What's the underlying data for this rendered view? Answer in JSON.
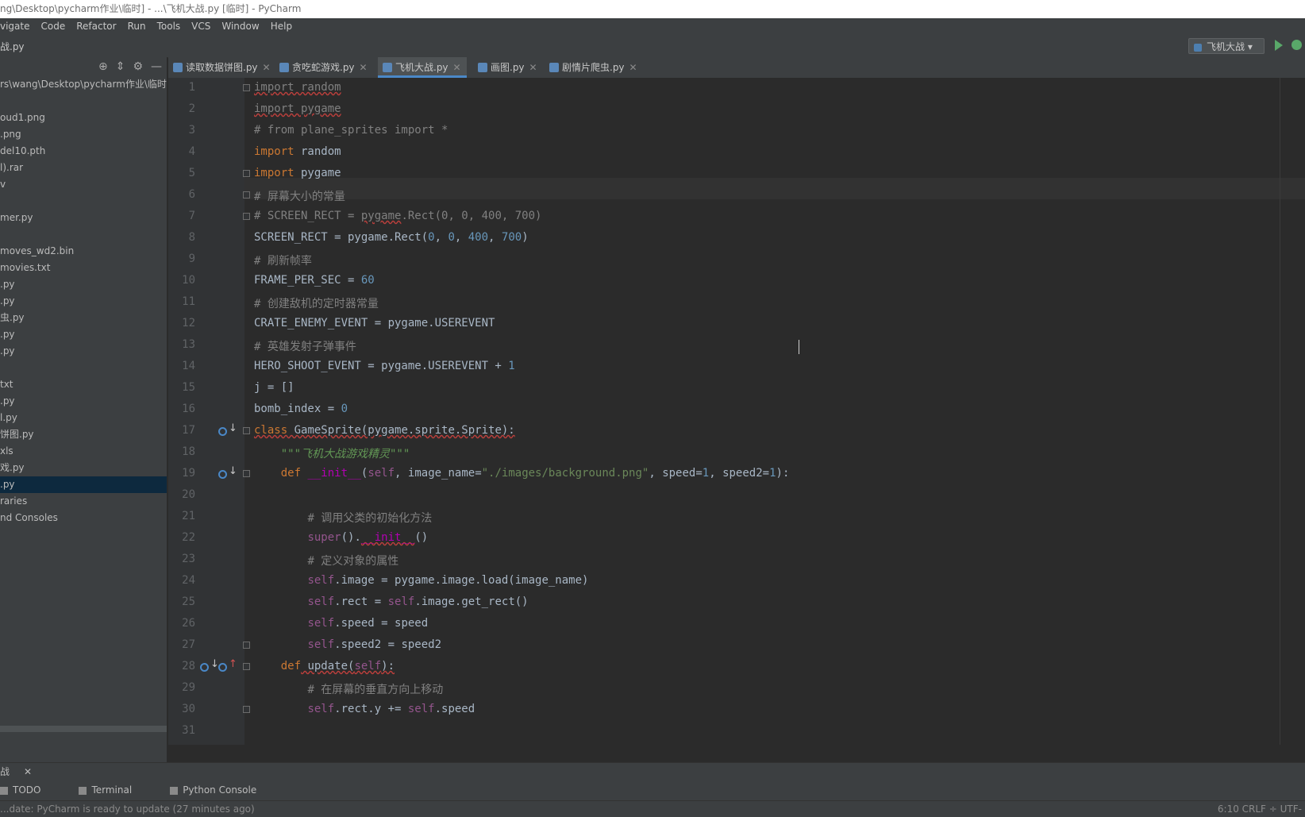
{
  "window": {
    "title": "ng\\Desktop\\pycharm作业\\临时] - ...\\飞机大战.py [临时] - PyCharm"
  },
  "menu": [
    "vigate",
    "Code",
    "Refactor",
    "Run",
    "Tools",
    "VCS",
    "Window",
    "Help"
  ],
  "nav": {
    "crumb": "战.py",
    "run_config": "飞机大战"
  },
  "project": {
    "root_path": "rs\\wang\\Desktop\\pycharm作业\\临时",
    "items": [
      "",
      "oud1.png",
      ".png",
      "del10.pth",
      "l).rar",
      "v",
      "",
      "mer.py",
      "",
      "moves_wd2.bin",
      "movies.txt",
      ".py",
      ".py",
      "虫.py",
      ".py",
      ".py",
      "",
      "txt",
      ".py",
      "l.py",
      "饼图.py",
      "xls",
      "戏.py",
      ".py",
      "raries",
      "nd Consoles"
    ],
    "selected_index": 23
  },
  "tabs": [
    {
      "label": "读取数据饼图.py",
      "active": false
    },
    {
      "label": "贪吃蛇游戏.py",
      "active": false
    },
    {
      "label": "飞机大战.py",
      "active": true
    },
    {
      "label": "画图.py",
      "active": false
    },
    {
      "label": "剧情片爬虫.py",
      "active": false
    }
  ],
  "editor": {
    "line_numbers": [
      "1",
      "2",
      "3",
      "4",
      "5",
      "6",
      "7",
      "8",
      "9",
      "10",
      "11",
      "12",
      "13",
      "14",
      "15",
      "16",
      "17",
      "18",
      "19",
      "20",
      "21",
      "22",
      "23",
      "24",
      "25",
      "26",
      "27",
      "28",
      "29",
      "30",
      "31"
    ],
    "current_line": 6,
    "lines": {
      "l1": [
        "import random"
      ],
      "l2": [
        "import pygame"
      ],
      "l3": [
        "# from plane_sprites import *"
      ],
      "l4": [
        "import",
        " random"
      ],
      "l5": [
        "import",
        " pygame"
      ],
      "l6": [
        "# 屏幕大小的常量"
      ],
      "l7": [
        "# SCREEN_RECT = ",
        "pygame",
        ".Rect(0, 0, 400, 700)"
      ],
      "l8": [
        "SCREEN_RECT = pygame.Rect(",
        "0",
        ", ",
        "0",
        ", ",
        "400",
        ", ",
        "700",
        ")"
      ],
      "l9": [
        "# 刷新帧率"
      ],
      "l10": [
        "FRAME_PER_SEC = ",
        "60"
      ],
      "l11": [
        "# 创建敌机的定时器常量"
      ],
      "l12": [
        "CRATE_ENEMY_EVENT = pygame.USEREVENT"
      ],
      "l13": [
        "# 英雄发射子弹事件"
      ],
      "l14": [
        "HERO_SHOOT_EVENT = pygame.USEREVENT + ",
        "1"
      ],
      "l15": [
        "j = []"
      ],
      "l16": [
        "bomb_index = ",
        "0"
      ],
      "l17": [
        "class",
        " GameSprite(pygame.sprite.Sprite):"
      ],
      "l18": [
        "    ",
        "\"\"\"飞机大战游戏精灵\"\"\""
      ],
      "l19": [
        "    ",
        "def",
        " ",
        "__init__",
        "(",
        "self",
        ", image_name=",
        "\"./images/background.png\"",
        ", speed=",
        "1",
        ", speed2=",
        "1",
        "):"
      ],
      "l20": [
        ""
      ],
      "l21": [
        "        ",
        "# 调用父类的初始化方法"
      ],
      "l22": [
        "        ",
        "super",
        "().",
        "__init__",
        "()"
      ],
      "l23": [
        "        ",
        "# 定义对象的属性"
      ],
      "l24": [
        "        ",
        "self",
        ".image = pygame.image.load(image_name)"
      ],
      "l25": [
        "        ",
        "self",
        ".rect = ",
        "self",
        ".image.get_rect()"
      ],
      "l26": [
        "        ",
        "self",
        ".speed = speed"
      ],
      "l27": [
        "        ",
        "self",
        ".speed2 = speed2"
      ],
      "l28": [
        "    ",
        "def",
        " update(",
        "self",
        "):"
      ],
      "l29": [
        "        ",
        "# 在屏幕的垂直方向上移动"
      ],
      "l30": [
        "        ",
        "self",
        ".rect.y += ",
        "self",
        ".speed"
      ],
      "l31": [
        ""
      ]
    }
  },
  "bottom": {
    "run_tab": "战",
    "close": "✕"
  },
  "toolwindows": [
    "TODO",
    "Terminal",
    "Python Console"
  ],
  "status": {
    "left": "...date: PyCharm is ready to update (27 minutes ago)",
    "right": "6:10  CRLF ÷  UTF-"
  },
  "colors": {
    "keyword": "#cc7832",
    "comment": "#808080",
    "number": "#6897bb",
    "string": "#6a8759",
    "self": "#94558d",
    "selection": "#0d293e"
  }
}
